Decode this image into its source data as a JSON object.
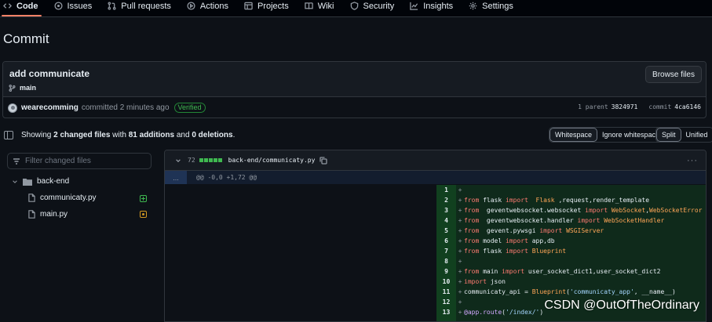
{
  "nav": {
    "items": [
      {
        "label": "Code",
        "icon": "code-icon",
        "active": true
      },
      {
        "label": "Issues",
        "icon": "issues-icon"
      },
      {
        "label": "Pull requests",
        "icon": "pull-request-icon"
      },
      {
        "label": "Actions",
        "icon": "play-icon"
      },
      {
        "label": "Projects",
        "icon": "table-icon"
      },
      {
        "label": "Wiki",
        "icon": "book-icon"
      },
      {
        "label": "Security",
        "icon": "shield-icon"
      },
      {
        "label": "Insights",
        "icon": "graph-icon"
      },
      {
        "label": "Settings",
        "icon": "gear-icon"
      }
    ]
  },
  "page_title": "Commit",
  "commit": {
    "message": "add communicate",
    "branch": "main",
    "browse_label": "Browse files",
    "author": "wearecomming",
    "committed_text": "committed 2 minutes ago",
    "verified_label": "Verified",
    "parent_label": "1 parent",
    "parent_sha": "3824971",
    "commit_label": "commit",
    "commit_sha": "4ca6146"
  },
  "summary": {
    "prefix": "Showing ",
    "changed_files": "2 changed files",
    "mid1": " with ",
    "additions": "81 additions",
    "mid2": " and ",
    "deletions": "0 deletions",
    "suffix": ".",
    "whitespace_label": "Whitespace",
    "ignore_whitespace_label": "Ignore whitespace",
    "split_label": "Split",
    "unified_label": "Unified"
  },
  "file_tree": {
    "filter_placeholder": "Filter changed files",
    "folder": "back-end",
    "files": [
      {
        "name": "communicaty.py",
        "status": "added"
      },
      {
        "name": "main.py",
        "status": "modified"
      }
    ]
  },
  "diff": {
    "count": "72",
    "file_path": "back-end/communicaty.py",
    "expand_label": "...",
    "hunk_header": "@@ -0,0 +1,72 @@",
    "lines": [
      {
        "n": "1",
        "code": ""
      },
      {
        "n": "2",
        "code": "from flask import  Flask ,request,render_template"
      },
      {
        "n": "3",
        "code": "from  geventwebsocket.websocket import WebSocket,WebSocketError"
      },
      {
        "n": "4",
        "code": "from  geventwebsocket.handler import WebSocketHandler"
      },
      {
        "n": "5",
        "code": "from  gevent.pywsgi import WSGIServer"
      },
      {
        "n": "6",
        "code": "from model import app,db"
      },
      {
        "n": "7",
        "code": "from flask import Blueprint"
      },
      {
        "n": "8",
        "code": ""
      },
      {
        "n": "9",
        "code": "from main import user_socket_dict1,user_socket_dict2"
      },
      {
        "n": "10",
        "code": "import json"
      },
      {
        "n": "11",
        "code": "communicaty_api = Blueprint('communicaty_app', __name__)"
      },
      {
        "n": "12",
        "code": ""
      },
      {
        "n": "13",
        "code": "@app.route('/index/')"
      }
    ]
  },
  "watermark": "CSDN @OutOfTheOrdinary"
}
